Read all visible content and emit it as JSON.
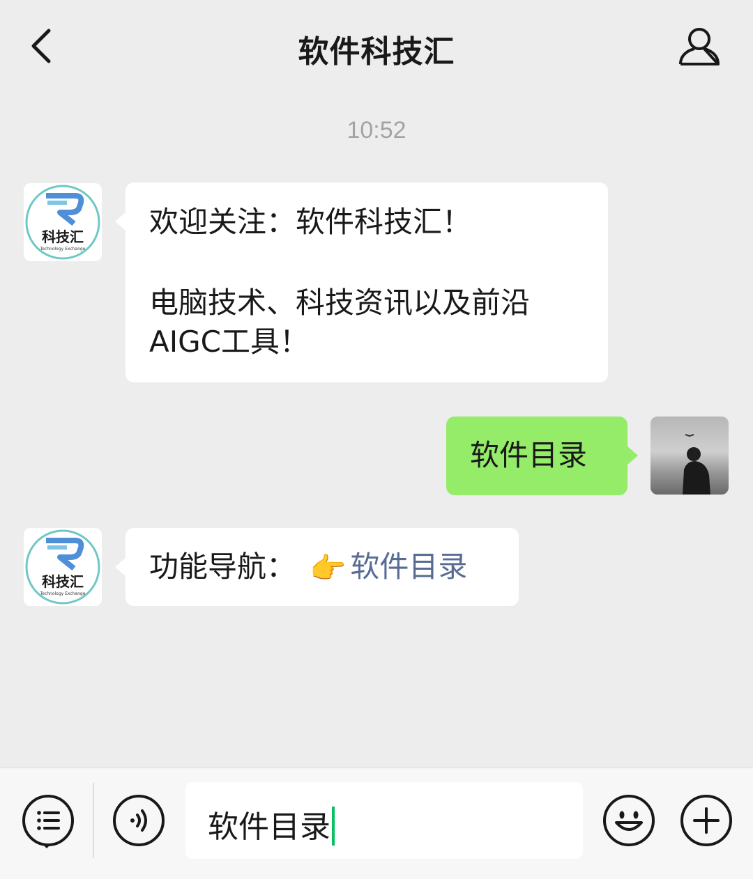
{
  "header": {
    "title": "软件科技汇",
    "back_icon": "chevron-left-icon",
    "profile_icon": "person-icon"
  },
  "timestamp": "10:52",
  "bot_avatar": {
    "brand_text": "科技汇",
    "subtitle": "Technology Exchange"
  },
  "messages": [
    {
      "from": "bot",
      "lines": [
        "欢迎关注：软件科技汇！",
        "",
        "电脑技术、科技资讯以及前沿",
        "AIGC工具！"
      ]
    },
    {
      "from": "user",
      "text": "软件目录"
    },
    {
      "from": "bot",
      "prefix": "功能导航：",
      "emoji": "👉",
      "link": "软件目录"
    }
  ],
  "input_bar": {
    "value": "软件目录",
    "menu_icon": "list-icon",
    "voice_icon": "voice-icon",
    "emoji_icon": "smiley-icon",
    "more_icon": "plus-icon"
  },
  "colors": {
    "background": "#ededed",
    "outgoing_bubble": "#95ec69",
    "incoming_bubble": "#ffffff",
    "link": "#576b95",
    "caret": "#07c160"
  }
}
